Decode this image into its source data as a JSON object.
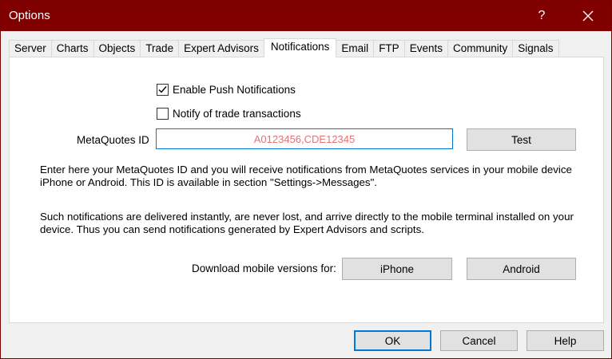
{
  "window": {
    "title": "Options",
    "help_label": "?"
  },
  "tabs": [
    {
      "label": "Server"
    },
    {
      "label": "Charts"
    },
    {
      "label": "Objects"
    },
    {
      "label": "Trade"
    },
    {
      "label": "Expert Advisors"
    },
    {
      "label": "Notifications",
      "active": true
    },
    {
      "label": "Email"
    },
    {
      "label": "FTP"
    },
    {
      "label": "Events"
    },
    {
      "label": "Community"
    },
    {
      "label": "Signals"
    }
  ],
  "notifications": {
    "enable_push": {
      "label": "Enable Push Notifications",
      "checked": true
    },
    "notify_trade": {
      "label": "Notify of trade transactions",
      "checked": false
    },
    "mqid_label": "MetaQuotes ID",
    "mqid_value": "",
    "mqid_placeholder": "A0123456,CDE12345",
    "test_label": "Test",
    "info_text_1": "Enter here your MetaQuotes ID and you will receive notifications from MetaQuotes services in your mobile device iPhone or Android. This ID is available in section \"Settings->Messages\".",
    "info_text_2": "Such notifications are delivered instantly, are never lost, and arrive directly to the mobile terminal installed on your device. Thus you can send notifications generated by Expert Advisors and scripts.",
    "download_label": "Download mobile versions for:",
    "iphone_label": "iPhone",
    "android_label": "Android"
  },
  "footer": {
    "ok_label": "OK",
    "cancel_label": "Cancel",
    "help_label": "Help"
  },
  "colors": {
    "titlebar": "#800000",
    "focus_border": "#0078d7",
    "placeholder": "#e57373"
  }
}
